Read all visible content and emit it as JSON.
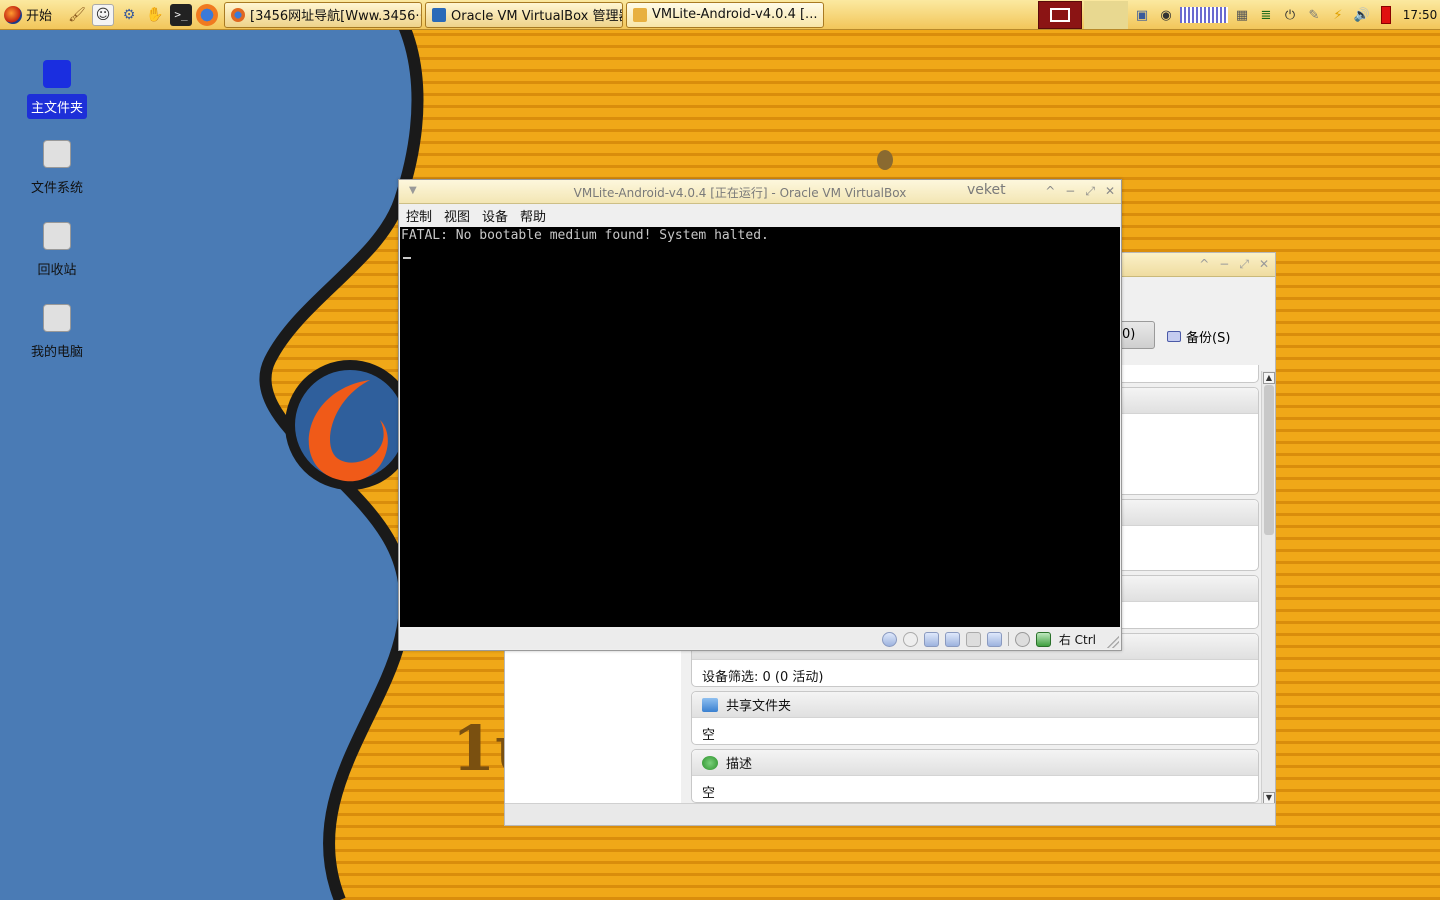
{
  "taskbar": {
    "start_label": "开始",
    "quick_icons": [
      "paint-icon",
      "face-icon",
      "network-icon",
      "hand-icon",
      "terminal-icon",
      "firefox-icon"
    ],
    "tasks": [
      {
        "label": "[3456网址导航[Www.3456···",
        "icon": "firefox-icon",
        "color": "#e06820"
      },
      {
        "label": "Oracle VM VirtualBox 管理器",
        "icon": "virtualbox-icon",
        "color": "#2a6ab8"
      },
      {
        "label": "VMLite-Android-v4.0.4 [...",
        "icon": "folder-icon",
        "color": "#e8b040"
      }
    ],
    "clock": "17:50"
  },
  "desktop": {
    "icons": [
      {
        "label": "主文件夹",
        "selected": true
      },
      {
        "label": "文件系统",
        "selected": false
      },
      {
        "label": "回收站",
        "selected": false
      },
      {
        "label": "我的电脑",
        "selected": false
      }
    ]
  },
  "manager": {
    "snapshot_label": "0)",
    "backup_label": "备份(S)",
    "sections": [
      {
        "header": "",
        "body": ""
      },
      {
        "header": "",
        "body": ""
      },
      {
        "header": "",
        "body": ""
      },
      {
        "header": "",
        "body": "设备筛选:  0 (0 活动)"
      },
      {
        "header": "共享文件夹",
        "body": "空"
      },
      {
        "header": "描述",
        "body": "空"
      }
    ]
  },
  "vm": {
    "title": "VMLite-Android-v4.0.4 [正在运行] - Oracle VM VirtualBox",
    "host": "veket",
    "menu": [
      "控制",
      "视图",
      "设备",
      "帮助"
    ],
    "console_text": "FATAL: No bootable medium found! System halted.",
    "host_key": "右 Ctrl"
  }
}
